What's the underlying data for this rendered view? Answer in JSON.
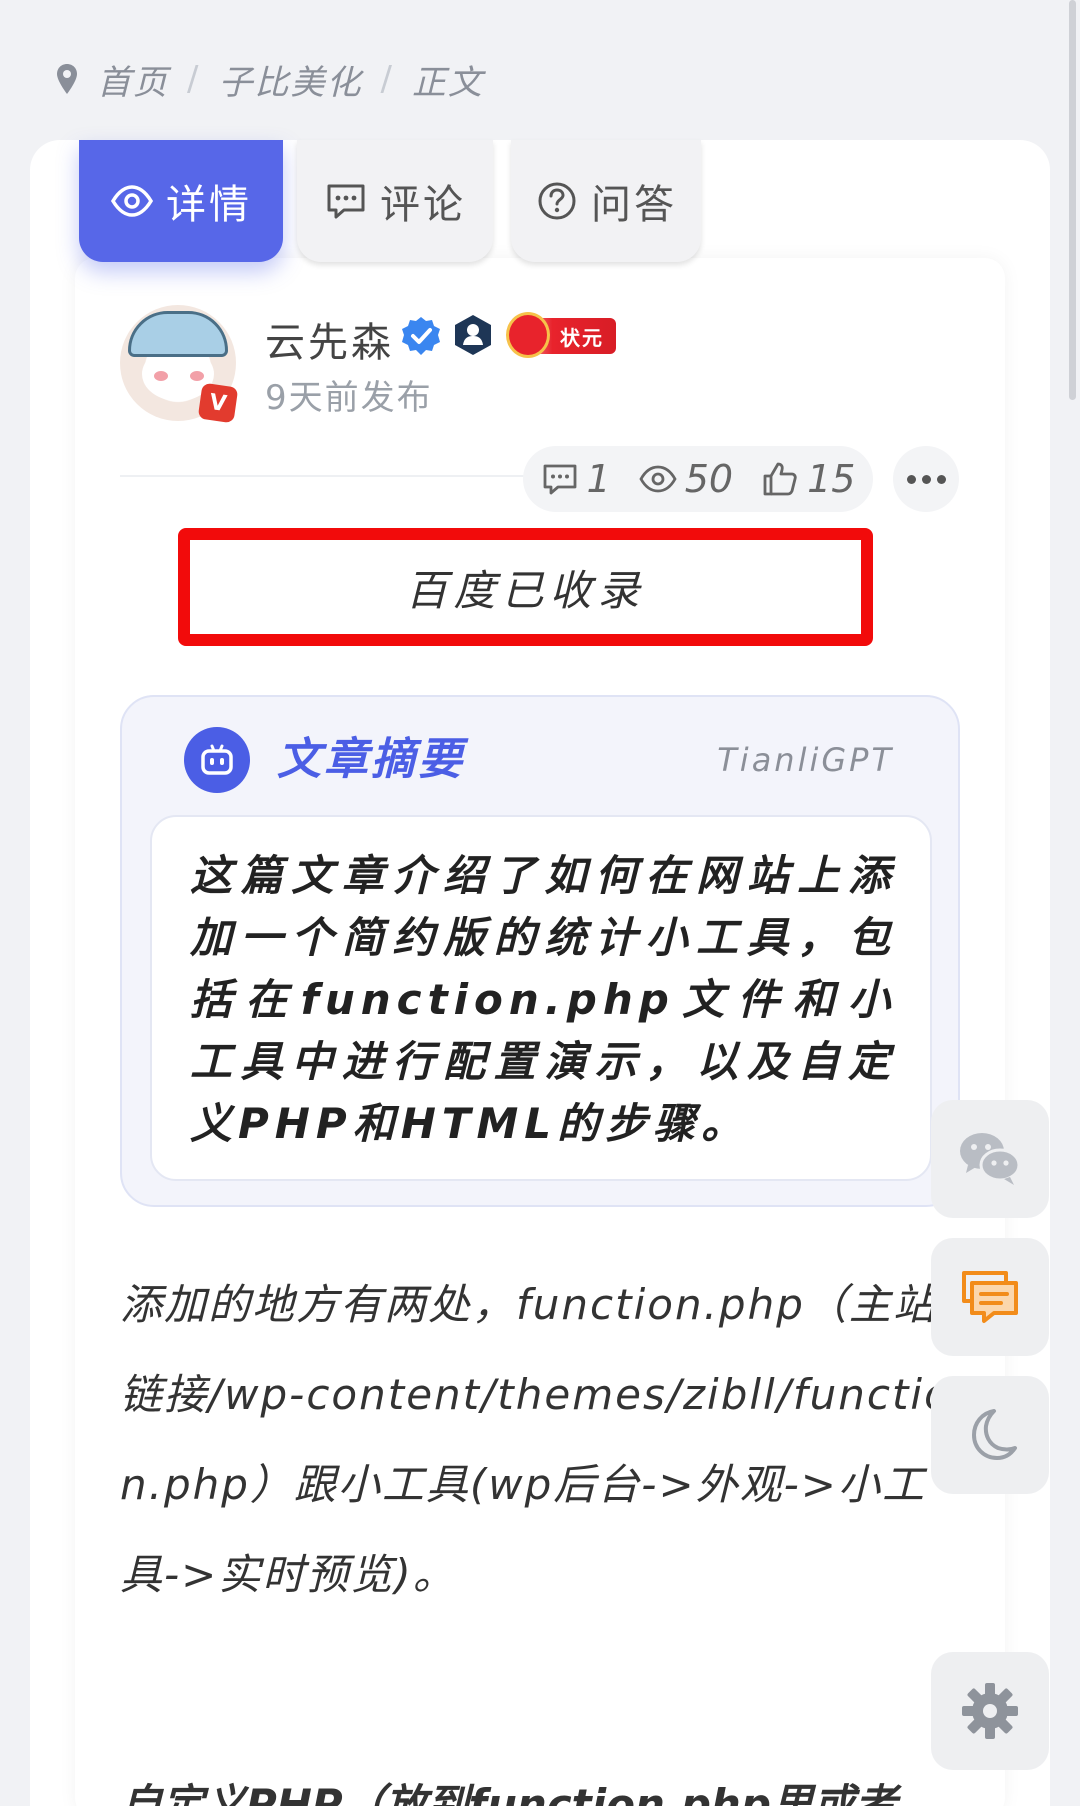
{
  "breadcrumb": {
    "home": "首页",
    "category": "子比美化",
    "current": "正文",
    "separator": "/"
  },
  "tabs": [
    {
      "label": "详情",
      "icon": "eye-icon",
      "active": true
    },
    {
      "label": "评论",
      "icon": "comment-icon",
      "active": false
    },
    {
      "label": "问答",
      "icon": "question-circle-icon",
      "active": false
    }
  ],
  "author": {
    "name": "云先森",
    "published": "9天前发布",
    "avatar_badge": "V",
    "rank_badge": "状元"
  },
  "stats": {
    "comments": "1",
    "views": "50",
    "likes": "15"
  },
  "baidu": {
    "label": "百度已收录"
  },
  "summary": {
    "title": "文章摘要",
    "brand": "TianliGPT",
    "text": "这篇文章介绍了如何在网站上添加一个简约版的统计小工具，包括在function.php文件和小工具中进行配置演示，以及自定义PHP和HTML的步骤。"
  },
  "article": {
    "paragraph1": "添加的地方有两处，function.php（主站链接/wp-content/themes/zibll/function.php）跟小工具(wp后台->外观->小工具->实时预览)。",
    "heading2": "自定义PHP（放到function.php里或者"
  },
  "colors": {
    "accent": "#5767e8",
    "summary_accent": "#4b5ee5",
    "highlight_border": "#f20b0b",
    "background": "#f1f2f5"
  },
  "floating_buttons": [
    "wechat-icon",
    "chat-icon",
    "moon-icon",
    "gear-icon"
  ]
}
